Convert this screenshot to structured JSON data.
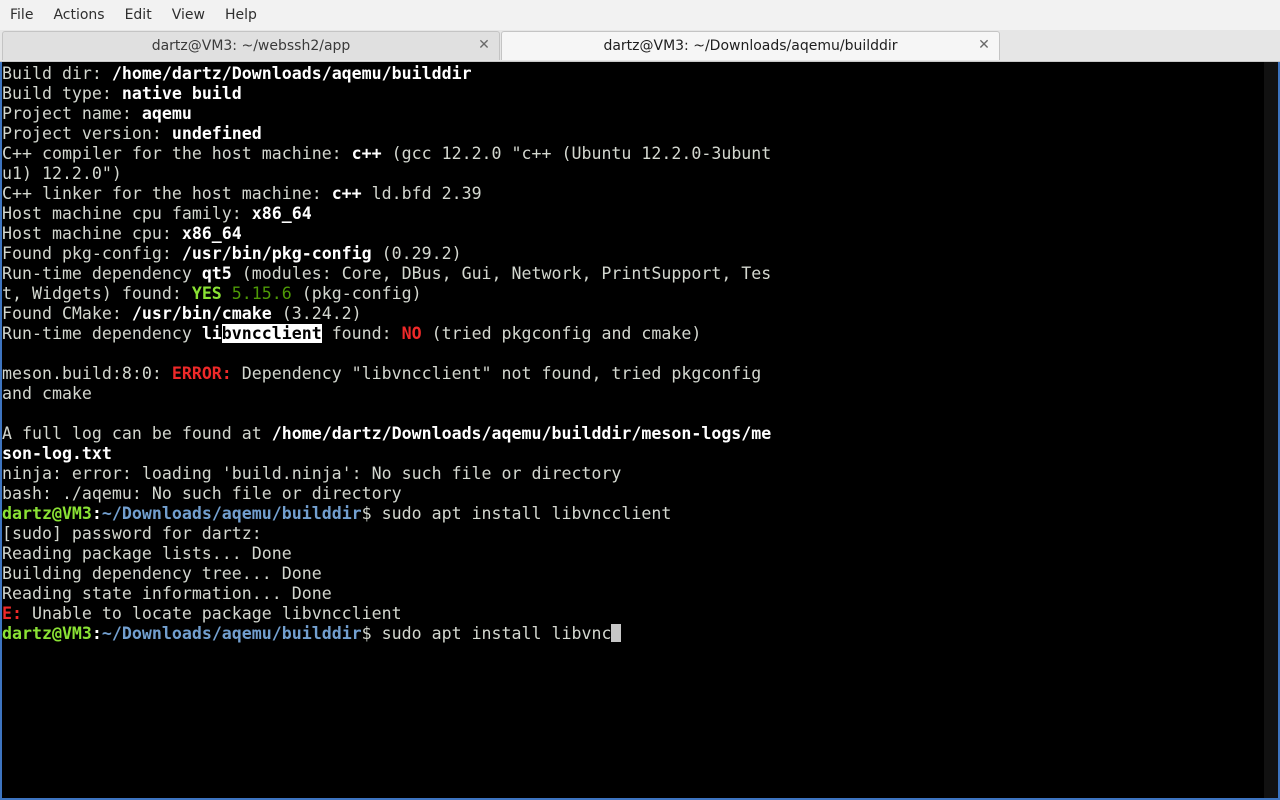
{
  "menu": [
    "File",
    "Actions",
    "Edit",
    "View",
    "Help"
  ],
  "tabs": [
    {
      "title": "dartz@VM3: ~/webssh2/app",
      "active": false
    },
    {
      "title": "dartz@VM3: ~/Downloads/aqemu/builddir",
      "active": true
    }
  ],
  "icons": {
    "tab_close": "close-icon"
  },
  "colors": {
    "accent": "#3d74c0",
    "prompt_user": "#8ae234",
    "prompt_path": "#729fcf",
    "error": "#ef2929"
  },
  "terminal": {
    "lines": [
      [
        {
          "t": "Build dir: "
        },
        {
          "t": "/home/dartz/Downloads/aqemu/builddir",
          "c": "b"
        }
      ],
      [
        {
          "t": "Build type: "
        },
        {
          "t": "native build",
          "c": "b"
        }
      ],
      [
        {
          "t": "Project name: "
        },
        {
          "t": "aqemu",
          "c": "b"
        }
      ],
      [
        {
          "t": "Project version: "
        },
        {
          "t": "undefined",
          "c": "b"
        }
      ],
      [
        {
          "t": "C++ compiler for the host machine: "
        },
        {
          "t": "c++",
          "c": "b"
        },
        {
          "t": " (gcc 12.2.0 \"c++ (Ubuntu 12.2.0-3ubunt"
        }
      ],
      [
        {
          "t": "u1) 12.2.0\")"
        }
      ],
      [
        {
          "t": "C++ linker for the host machine: "
        },
        {
          "t": "c++",
          "c": "b"
        },
        {
          "t": " ld.bfd 2.39"
        }
      ],
      [
        {
          "t": "Host machine cpu family: "
        },
        {
          "t": "x86_64",
          "c": "b"
        }
      ],
      [
        {
          "t": "Host machine cpu: "
        },
        {
          "t": "x86_64",
          "c": "b"
        }
      ],
      [
        {
          "t": "Found pkg-config: "
        },
        {
          "t": "/usr/bin/pkg-config",
          "c": "b"
        },
        {
          "t": " (0.29.2)"
        }
      ],
      [
        {
          "t": "Run-time dependency "
        },
        {
          "t": "qt5",
          "c": "b"
        },
        {
          "t": " (modules: Core, DBus, Gui, Network, PrintSupport, Tes"
        }
      ],
      [
        {
          "t": "t, Widgets) found: "
        },
        {
          "t": "YES",
          "c": "grn"
        },
        {
          "t": " 5.15.6",
          "c": "grn2"
        },
        {
          "t": " (pkg-config)"
        }
      ],
      [
        {
          "t": "Found CMake: "
        },
        {
          "t": "/usr/bin/cmake",
          "c": "b"
        },
        {
          "t": " (3.24.2)"
        }
      ],
      [
        {
          "t": "Run-time dependency "
        },
        {
          "t": "li",
          "c": "b"
        },
        {
          "t": "bvncclient",
          "c": "hl"
        },
        {
          "t": " found: "
        },
        {
          "t": "NO",
          "c": "red"
        },
        {
          "t": " (tried pkgconfig and cmake)"
        }
      ],
      [
        {
          "t": ""
        }
      ],
      [
        {
          "t": "meson.build:8:0: "
        },
        {
          "t": "ERROR:",
          "c": "red"
        },
        {
          "t": " Dependency \"libvncclient\" not found, tried pkgconfig"
        }
      ],
      [
        {
          "t": "and cmake"
        }
      ],
      [
        {
          "t": ""
        }
      ],
      [
        {
          "t": "A full log can be found at "
        },
        {
          "t": "/home/dartz/Downloads/aqemu/builddir/meson-logs/me",
          "c": "b"
        }
      ],
      [
        {
          "t": "son-log.txt",
          "c": "b"
        }
      ],
      [
        {
          "t": "ninja: error: loading 'build.ninja': No such file or directory"
        }
      ],
      [
        {
          "t": "bash: ./aqemu: No such file or directory"
        }
      ],
      [
        {
          "t": "dartz@VM3",
          "c": "pu"
        },
        {
          "t": ":",
          "c": "b"
        },
        {
          "t": "~/Downloads/aqemu/builddir",
          "c": "pp"
        },
        {
          "t": "$ sudo apt install libvncclient"
        }
      ],
      [
        {
          "t": "[sudo] password for dartz:"
        }
      ],
      [
        {
          "t": "Reading package lists... Done"
        }
      ],
      [
        {
          "t": "Building dependency tree... Done"
        }
      ],
      [
        {
          "t": "Reading state information... Done"
        }
      ],
      [
        {
          "t": "E:",
          "c": "red"
        },
        {
          "t": " Unable to locate package libvncclient"
        }
      ],
      [
        {
          "t": "dartz@VM3",
          "c": "pu"
        },
        {
          "t": ":",
          "c": "b"
        },
        {
          "t": "~/Downloads/aqemu/builddir",
          "c": "pp"
        },
        {
          "t": "$ sudo apt install libvnc"
        }
      ]
    ]
  }
}
